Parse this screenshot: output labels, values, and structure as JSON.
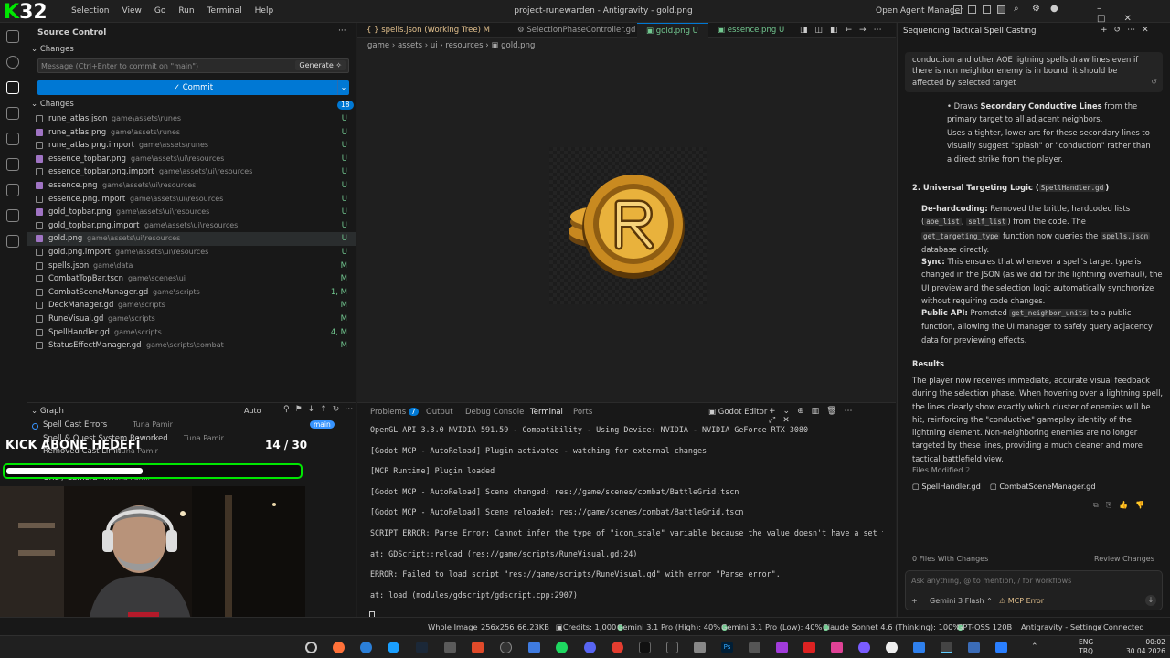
{
  "titlebar": {
    "menu": [
      "Selection",
      "View",
      "Go",
      "Run",
      "Terminal",
      "Help"
    ],
    "title": "project-runewarden - Antigravity - gold.png",
    "agent_manager": "Open Agent Manager"
  },
  "overlay": {
    "logo_number": "32",
    "kick_text": "KICK ABONE HEDEFİ",
    "count_text": "14 / 30",
    "progress_fraction": 0.467
  },
  "sidebar": {
    "title": "Source Control",
    "changes_header": "Changes",
    "commit_placeholder": "Message (Ctrl+Enter to commit on \"main\")",
    "generate_label": "Generate",
    "commit_label": "Commit",
    "changes_group": "Changes",
    "changes_count": "18",
    "files": [
      {
        "name": "rune_atlas.json",
        "path": "game\\assets\\runes",
        "status": "U"
      },
      {
        "name": "rune_atlas.png",
        "path": "game\\assets\\runes",
        "status": "U"
      },
      {
        "name": "rune_atlas.png.import",
        "path": "game\\assets\\runes",
        "status": "U"
      },
      {
        "name": "essence_topbar.png",
        "path": "game\\assets\\ui\\resources",
        "status": "U"
      },
      {
        "name": "essence_topbar.png.import",
        "path": "game\\assets\\ui\\resources",
        "status": "U"
      },
      {
        "name": "essence.png",
        "path": "game\\assets\\ui\\resources",
        "status": "U"
      },
      {
        "name": "essence.png.import",
        "path": "game\\assets\\ui\\resources",
        "status": "U"
      },
      {
        "name": "gold_topbar.png",
        "path": "game\\assets\\ui\\resources",
        "status": "U"
      },
      {
        "name": "gold_topbar.png.import",
        "path": "game\\assets\\ui\\resources",
        "status": "U"
      },
      {
        "name": "gold.png",
        "path": "game\\assets\\ui\\resources",
        "status": "U"
      },
      {
        "name": "gold.png.import",
        "path": "game\\assets\\ui\\resources",
        "status": "U"
      },
      {
        "name": "spells.json",
        "path": "game\\data",
        "status": "M"
      },
      {
        "name": "CombatTopBar.tscn",
        "path": "game\\scenes\\ui",
        "status": "M"
      },
      {
        "name": "CombatSceneManager.gd",
        "path": "game\\scripts",
        "status": "1, M"
      },
      {
        "name": "DeckManager.gd",
        "path": "game\\scripts",
        "status": "M"
      },
      {
        "name": "RuneVisual.gd",
        "path": "game\\scripts",
        "status": "M"
      },
      {
        "name": "SpellHandler.gd",
        "path": "game\\scripts",
        "status": "4, M"
      },
      {
        "name": "StatusEffectManager.gd",
        "path": "game\\scripts\\combat",
        "status": "M"
      }
    ],
    "graph_title": "Graph",
    "graph_auto": "Auto",
    "graph_items": [
      {
        "msg": "Spell Cast Errors",
        "author": "Tuna Pamir",
        "branch": "main"
      },
      {
        "msg": "Spell & Quest System Reworked",
        "author": "Tuna Pamir"
      },
      {
        "msg": "Removed Cast Limit",
        "author": "Tuna Pamir"
      },
      {
        "msg": "Grid / Camera Fix",
        "author": "Tuna Pamir"
      }
    ]
  },
  "editor": {
    "tabs": [
      {
        "label": "spells.json (Working Tree)",
        "badge": "M"
      },
      {
        "label": "SelectionPhaseController.gd",
        "badge": ""
      },
      {
        "label": "gold.png",
        "badge": "U"
      },
      {
        "label": "essence.png",
        "badge": "U"
      }
    ],
    "breadcrumb": [
      "game",
      "assets",
      "ui",
      "resources",
      "gold.png"
    ]
  },
  "panel": {
    "tabs": [
      "Problems",
      "Output",
      "Debug Console",
      "Terminal",
      "Ports"
    ],
    "problems_count": "7",
    "terminal_name": "Godot Editor",
    "lines": [
      "OpenGL API 3.3.0 NVIDIA 591.59 - Compatibility - Using Device: NVIDIA - NVIDIA GeForce RTX 3080",
      "[Godot MCP - AutoReload] Plugin activated - watching for external changes",
      "[MCP Runtime] Plugin loaded",
      "[Godot MCP - AutoReload] Scene changed: res://game/scenes/combat/BattleGrid.tscn",
      "[Godot MCP - AutoReload] Scene reloaded: res://game/scenes/combat/BattleGrid.tscn",
      "SCRIPT ERROR: Parse Error: Cannot infer the type of \"icon_scale\" variable because the value doesn't have a set type.",
      "   at: GDScript::reload (res://game/scripts/RuneVisual.gd:24)",
      "ERROR: Failed to load script \"res://game/scripts/RuneVisual.gd\" with error \"Parse error\".",
      "   at: load (modules/gdscript/gdscript.cpp:2907)"
    ]
  },
  "chat": {
    "title": "Sequencing Tactical Spell Casting",
    "user_msg": "conduction and other AOE ligtning spells draw lines even if there is non neighbor enemy is in bound. it should be affected by selected target",
    "bullet1_pre": "Draws ",
    "bullet1_b": "Secondary Conductive Lines",
    "bullet1_post": " from the primary target to all adjacent neighbors.",
    "bullet2": "Uses a tighter, lower arc for these secondary lines to visually suggest \"splash\" or \"conduction\" rather than a direct strike from the player.",
    "h2_pre": "2. Universal Targeting Logic (",
    "h2_code": "SpellHandler.gd",
    "h2_post": ")",
    "p1_b": "De-hardcoding:",
    "p1_a": " Removed the brittle, hardcoded lists (",
    "p1_c1": "aoe_list",
    "p1_c2": "self_list",
    "p1_b2": ") from the code. The ",
    "p1_c3": "get_targeting_type",
    "p1_c": " function now queries the ",
    "p1_c4": "spells.json",
    "p1_d": " database directly.",
    "p2_b": "Sync:",
    "p2_t": " This ensures that whenever a spell's target type is changed in the JSON (as we did for the lightning overhaul), the UI preview and the selection logic automatically synchronize without requiring code changes.",
    "p3_b": "Public API:",
    "p3_a": " Promoted ",
    "p3_c": "get_neighbor_units",
    "p3_t": " to a public function, allowing the UI manager to safely query adjacency data for previewing effects.",
    "results_h": "Results",
    "results_t": "The player now receives immediate, accurate visual feedback during the selection phase. When hovering over a lightning spell, the lines clearly show exactly which cluster of enemies will be hit, reinforcing the \"conductive\" gameplay identity of the lightning element. Non-neighboring enemies are no longer targeted by these lines, providing a much cleaner and more tactical battlefield view.",
    "files_modified": "Files Modified",
    "files_count": "2",
    "file1": "SpellHandler.gd",
    "file2": "CombatSceneManager.gd",
    "files_with_changes": "0 Files With Changes",
    "review": "Review Changes",
    "input_placeholder": "Ask anything, @ to mention, / for workflows",
    "model": "Gemini 3 Flash",
    "mcp": "MCP Error"
  },
  "status": {
    "view": "Whole Image",
    "dims": "256x256",
    "size": "66.23KB",
    "credits": "Credits: 1,000",
    "q1": "Gemini 3.1 Pro (High): 40%",
    "q2": "Gemini 3.1 Pro (Low): 40%",
    "q3": "Claude Sonnet 4.6 (Thinking): 100%",
    "q4": "GPT-OSS 120B",
    "settings": "Antigravity - Settings",
    "connected": "Connected"
  },
  "taskbar": {
    "lang1": "ENG",
    "lang2": "TRQ",
    "time": "00:02",
    "date": "30.04.2026"
  },
  "colors": {
    "accent": "#0078d4",
    "untracked": "#73c991",
    "modified": "#e2c08d",
    "error": "#f14c4c",
    "kick_green": "#00e701"
  }
}
